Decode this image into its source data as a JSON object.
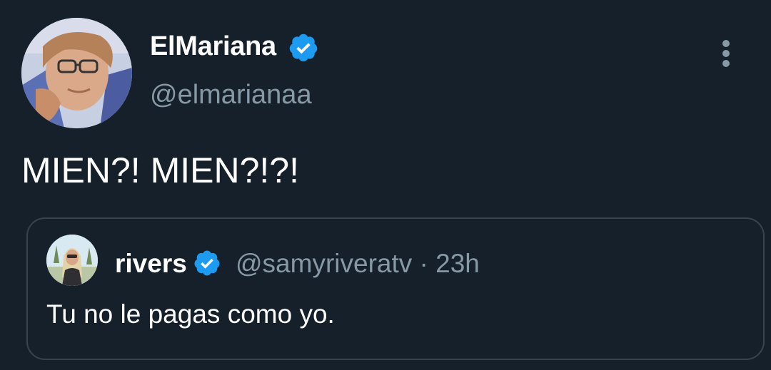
{
  "tweet": {
    "author": {
      "display_name": "ElMariana",
      "handle": "@elmarianaa",
      "verified": true
    },
    "text": "MIEN?! MIEN?!?!",
    "quoted_tweet": {
      "author": {
        "display_name": "rivers",
        "handle": "@samyriveratv",
        "verified": true
      },
      "separator": "·",
      "time_ago": "23h",
      "text": "Tu no le pagas como yo."
    }
  },
  "colors": {
    "background": "#15202b",
    "primary_text": "#ffffff",
    "secondary_text": "#8899a6",
    "verified_badge": "#1d9bf0",
    "quote_border": "#38444d"
  },
  "icons": {
    "more": "more-vertical-icon",
    "verified": "verified-badge-icon"
  }
}
